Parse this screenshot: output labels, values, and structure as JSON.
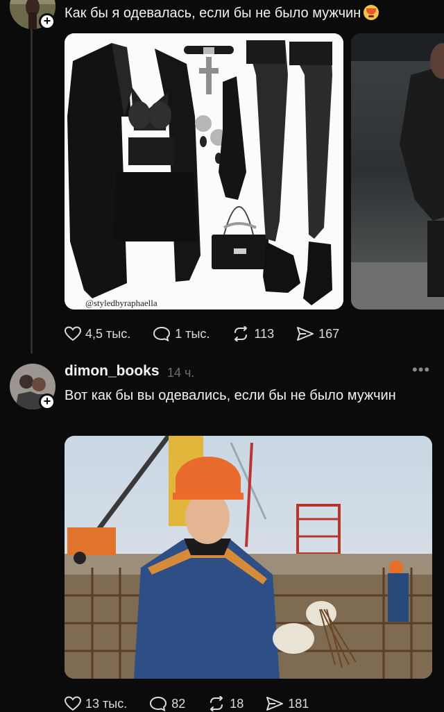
{
  "post1": {
    "text": "Как бы я одевалась, если бы не было мужчин",
    "emoji_icon": "hot-face-emoji-icon",
    "image_watermark": "@styledbyraphaella",
    "stats": {
      "likes": "4,5 тыс.",
      "comments": "1 тыс.",
      "reposts": "113",
      "shares": "167"
    }
  },
  "post2": {
    "username": "dimon_books",
    "time": "14 ч.",
    "text": "Вот как бы вы одевались, если бы не было мужчин",
    "stats": {
      "likes": "13 тыс.",
      "comments": "82",
      "reposts": "18",
      "shares": "181"
    }
  },
  "icons": {
    "like": "heart-icon",
    "comment": "speech-bubble-icon",
    "repost": "repost-arrows-icon",
    "share": "paper-plane-icon",
    "more": "more-dots-icon",
    "follow": "plus-icon"
  },
  "colors": {
    "background": "#0b0b0b",
    "text": "#f2f2f2",
    "muted": "#6e6e6e",
    "thread_line": "#2f2f2f"
  }
}
